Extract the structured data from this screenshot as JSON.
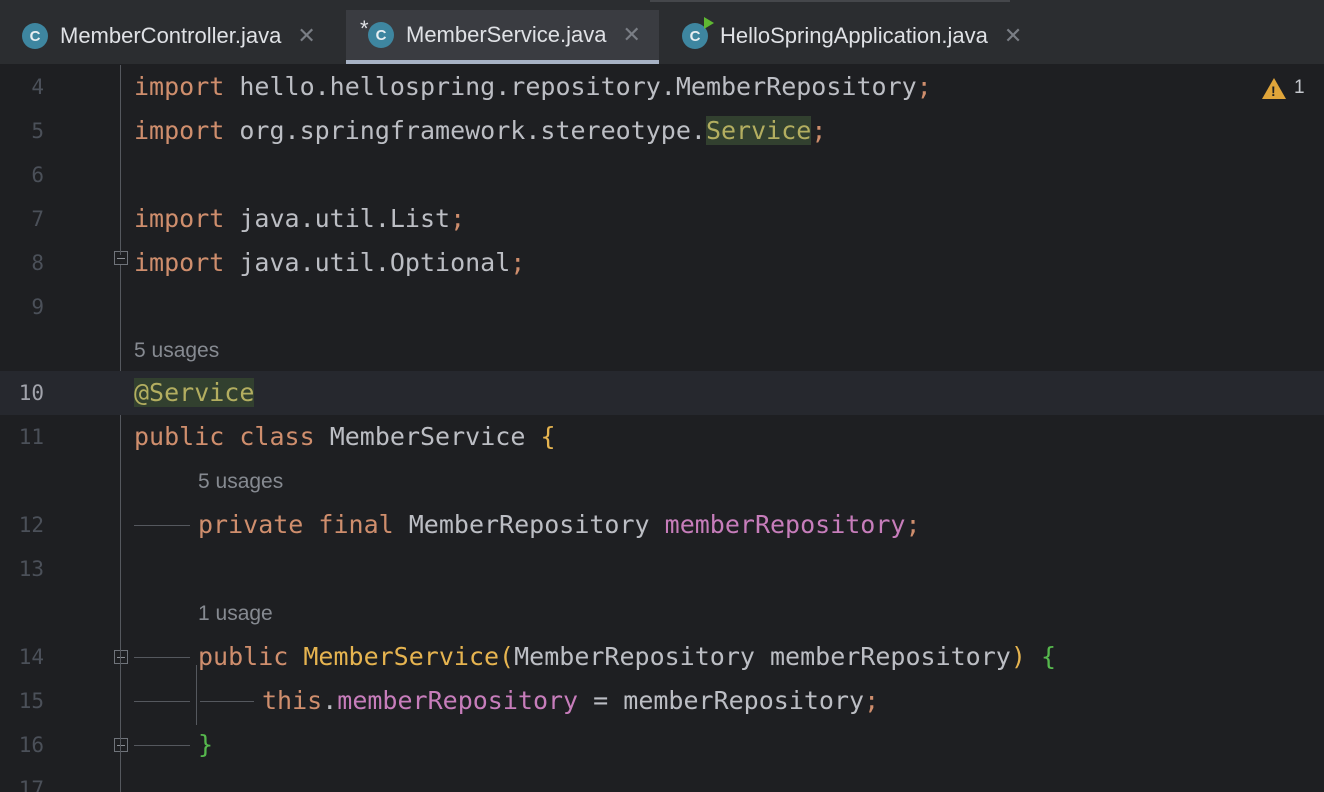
{
  "tabs": [
    {
      "label": "MemberController.java",
      "icon": "class-icon",
      "modified": false,
      "active": false
    },
    {
      "label": "MemberService.java",
      "icon": "class-icon",
      "modified": true,
      "active": true
    },
    {
      "label": "HelloSpringApplication.java",
      "icon": "runnable-class-icon",
      "modified": false,
      "active": false
    }
  ],
  "tab_close_glyph": "✕",
  "modified_marker": "*",
  "class_icon_letter": "C",
  "warnings": {
    "count": "1",
    "icon": "warning-triangle-icon",
    "color": "#e0a53a"
  },
  "lines": {
    "l4": {
      "number": "4",
      "kw": "import",
      "rest": " hello.hellospring.repository.MemberRepository",
      "semi": ";"
    },
    "l5": {
      "number": "5",
      "kw": "import",
      "rest": " org.springframework.stereotype.",
      "hl": "Service",
      "semi": ";"
    },
    "l6": {
      "number": "6"
    },
    "l7": {
      "number": "7",
      "kw": "import",
      "rest": " java.util.List",
      "semi": ";"
    },
    "l8": {
      "number": "8",
      "kw": "import",
      "rest": " java.util.Optional",
      "semi": ";"
    },
    "l9": {
      "number": "9"
    },
    "hint_class": "5 usages",
    "l10": {
      "number": "10",
      "ann": "@Service"
    },
    "l11": {
      "number": "11",
      "kw1": "public",
      "kw2": "class",
      "name": "MemberService",
      "brace": "{"
    },
    "hint_field": "5 usages",
    "l12": {
      "number": "12",
      "kw1": "private",
      "kw2": "final",
      "type": "MemberRepository",
      "field": "memberRepository",
      "semi": ";"
    },
    "l13": {
      "number": "13"
    },
    "hint_ctor": "1 usage",
    "l14": {
      "number": "14",
      "kw": "public",
      "name": "MemberService",
      "open": "(",
      "type": "MemberRepository",
      "param": "memberRepository",
      "close": ")",
      "brace": "{"
    },
    "l15": {
      "number": "15",
      "kw": "this",
      "dot": ".",
      "field": "memberRepository",
      "op": " = ",
      "value": "memberRepository",
      "semi": ";"
    },
    "l16": {
      "number": "16",
      "brace": "}"
    },
    "l17": {
      "number": "17"
    }
  },
  "colors": {
    "background": "#1e1f22",
    "keyword": "#cf8e6d",
    "annotation": "#b3ae60",
    "field": "#c77dbb",
    "method": "#e6b450",
    "tab_bar": "#2b2d30"
  }
}
